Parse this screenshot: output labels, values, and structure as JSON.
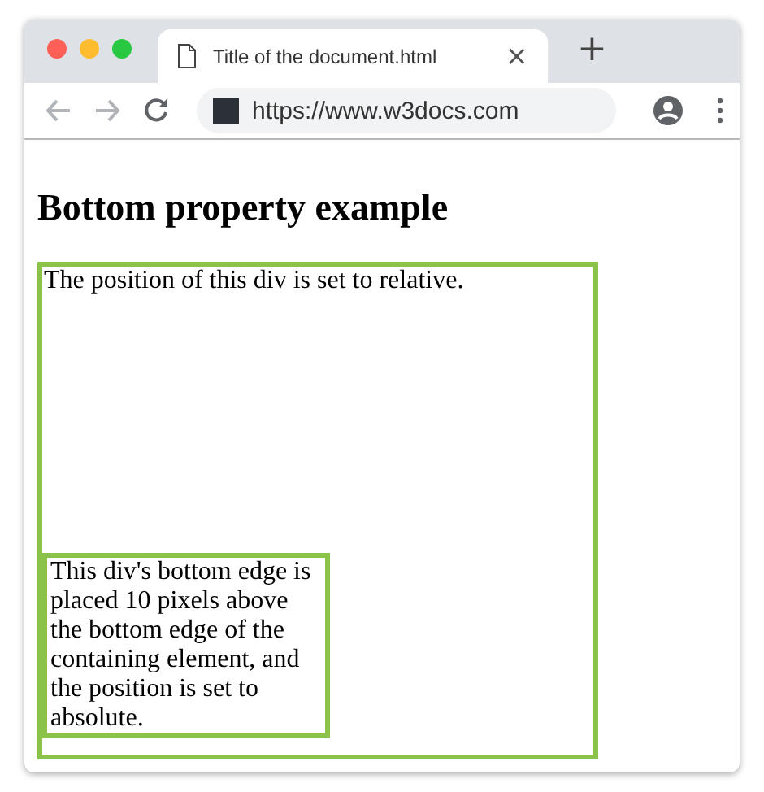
{
  "browser": {
    "tab_title": "Title of the document.html",
    "tab_close": "×",
    "new_tab": "+",
    "url": "https://www.w3docs.com"
  },
  "page": {
    "heading": "Bottom property example",
    "relative_box_text": "The position of this div is set to relative.",
    "absolute_box_text": "This div's bottom edge is placed 10 pixels above the bottom edge of the containing element, and the position is set to absolute."
  }
}
